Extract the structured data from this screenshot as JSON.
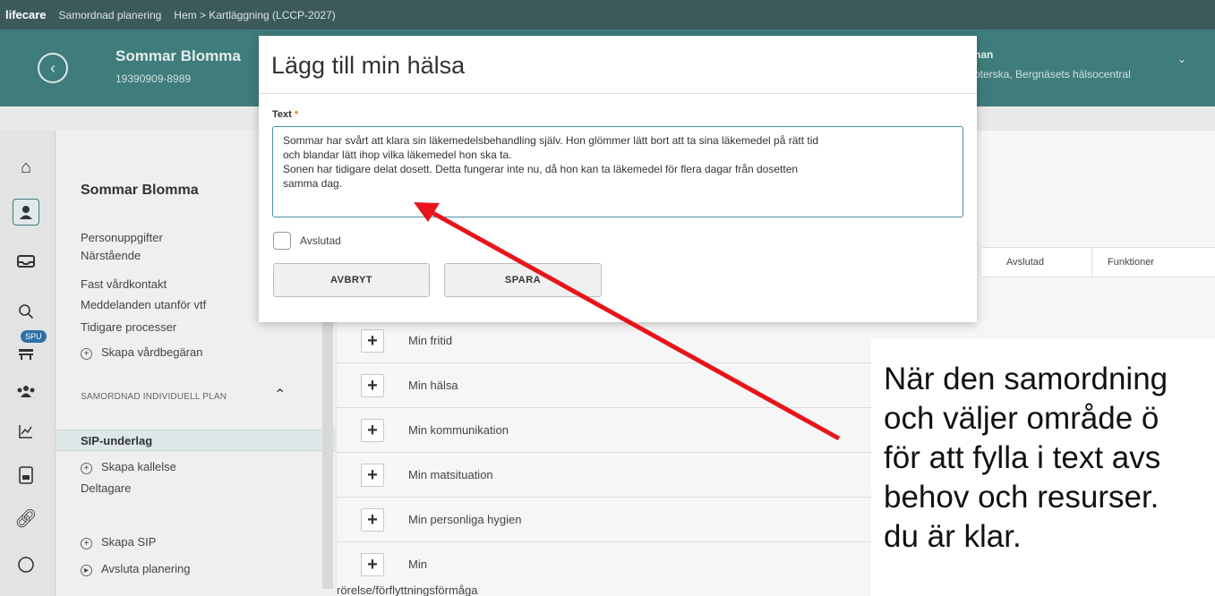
{
  "topbar": {
    "logo": "lifecare",
    "app": "Samordnad planering",
    "breadcrumb": "Hem > Kartläggning (LCCP-2027)"
  },
  "patient": {
    "name": "Sommar Blomma",
    "id": "19390909-8989"
  },
  "user": {
    "name": "nan",
    "role": "oterska, Bergnäsets hälsocentral"
  },
  "sidebar": {
    "title": "Sommar Blomma",
    "items": [
      "Personuppgifter",
      "Närstående",
      "Fast vårdkontakt",
      "Meddelanden utanför vtf",
      "Tidigare processer"
    ],
    "create_request": "Skapa vårdbegäran",
    "section": "SAMORDNAD INDIVIDUELL PLAN",
    "active": "SIP-underlag",
    "create_call": "Skapa kallelse",
    "participants": "Deltagare",
    "create_sip": "Skapa SIP",
    "end_planning": "Avsluta planering",
    "spu_badge": "SPU"
  },
  "table": {
    "columns": [
      "Avslutad",
      "Funktioner"
    ],
    "rows": [
      "Min fritid",
      "Min hälsa",
      "Min kommunikation",
      "Min matsituation",
      "Min personliga hygien",
      "Min",
      "rörelse/förflyttningsförmåga"
    ]
  },
  "modal": {
    "title": "Lägg till min hälsa",
    "text_label": "Text",
    "required_mark": "*",
    "text_value": "Sommar har svårt att klara sin läkemedelsbehandling själv. Hon glömmer lätt bort att ta sina läkemedel på rätt tid\noch blandar lätt ihop vilka läkemedel hon ska ta.\nSonen har tidigare delat dosett. Detta fungerar inte nu, då hon kan ta läkemedel för flera dagar från dosetten\nsamma dag.",
    "checkbox_label": "Avslutad",
    "cancel_label": "AVBRYT",
    "save_label": "SPARA"
  },
  "annotation": {
    "text": "När den samordning\noch väljer område ö\nför att fylla i text avs\nbehov och resurser.\ndu är klar.",
    "arrow_color": "#e8141b"
  }
}
